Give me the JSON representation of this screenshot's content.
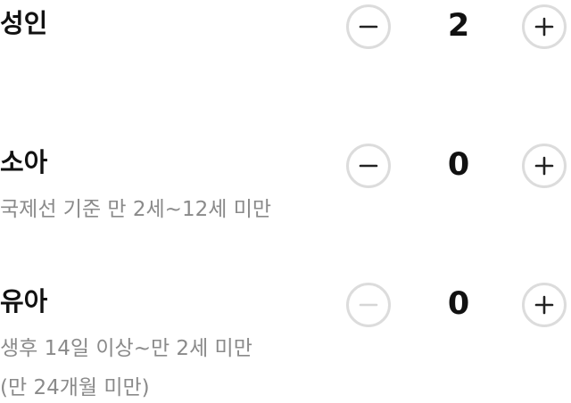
{
  "passengers": {
    "adult": {
      "label": "성인",
      "count": "2",
      "minus_enabled": true,
      "plus_enabled": true
    },
    "child": {
      "label": "소아",
      "description": "국제선 기준 만 2세~12세 미만",
      "count": "0",
      "minus_enabled": true,
      "plus_enabled": true
    },
    "infant": {
      "label": "유아",
      "description": "생후 14일 이상~만 2세 미만",
      "description_line2": "(만 24개월 미만)",
      "count": "0",
      "minus_enabled": false,
      "plus_enabled": true
    }
  },
  "icons": {
    "minus": "minus-icon",
    "plus": "plus-icon"
  },
  "colors": {
    "text": "#111111",
    "secondary_text": "#8a8a8a",
    "button_border": "#dcdcdc",
    "icon_active": "#222222",
    "icon_disabled": "#d6d6d6"
  }
}
